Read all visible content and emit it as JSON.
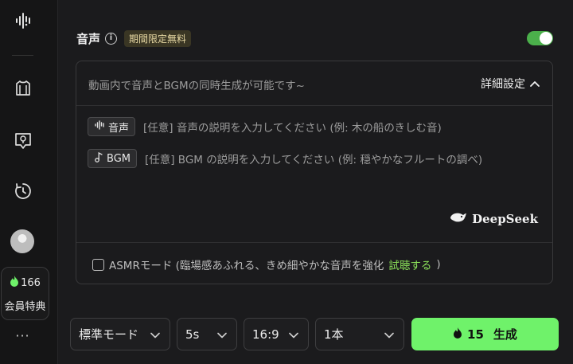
{
  "sidebar": {
    "credits": "166",
    "member_label": "会員特典",
    "more": "···"
  },
  "audio": {
    "title": "音声",
    "info": "i",
    "promo": "期間限定無料",
    "toggle_on": true
  },
  "panel": {
    "hint": "動画内で音声とBGMの同時生成が可能です~",
    "detail_label": "詳細設定",
    "voice_chip": "音声",
    "voice_placeholder": "[任意] 音声の説明を入力してください (例: 木の船のきしむ音)",
    "bgm_chip": "BGM",
    "bgm_placeholder": "[任意] BGM の説明を入力してください (例: 穏やかなフルートの調べ)",
    "brand": "DeepSeek",
    "asmr_label": "ASMRモード (臨場感あふれる、きめ細やかな音声を強化",
    "asmr_try": "試聴する",
    "asmr_close": ")"
  },
  "controls": {
    "mode": "標準モード",
    "duration": "5s",
    "ratio": "16:9",
    "count": "1本",
    "generate_cost": "15",
    "generate_label": "生成"
  },
  "colors": {
    "accent_green": "#6ff26a",
    "toggle_green": "#4bb04b",
    "try_green": "#8be05a",
    "background": "#1b1b1d"
  }
}
